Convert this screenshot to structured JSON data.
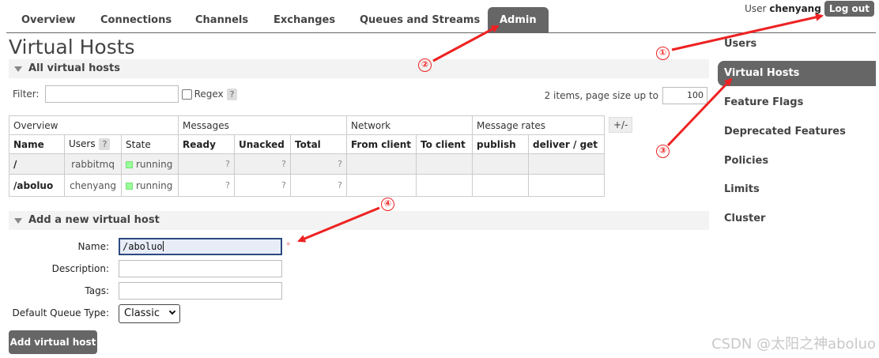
{
  "nav": {
    "tabs": [
      {
        "label": "Overview"
      },
      {
        "label": "Connections"
      },
      {
        "label": "Channels"
      },
      {
        "label": "Exchanges"
      },
      {
        "label": "Queues and Streams"
      },
      {
        "label": "Admin",
        "active": true
      }
    ]
  },
  "user": {
    "prefix": "User",
    "name": "chenyang",
    "logout": "Log out"
  },
  "page_title": "Virtual Hosts",
  "all_vhosts": {
    "header": "All virtual hosts",
    "filter_label": "Filter:",
    "filter_value": "",
    "regex_label": "Regex",
    "help": "?",
    "items_text": "2 items, page size up to",
    "page_size": "100",
    "toggle": "+/-"
  },
  "table": {
    "groups": [
      "Overview",
      "Messages",
      "Network",
      "Message rates"
    ],
    "columns": [
      "Name",
      "Users",
      "State",
      "Ready",
      "Unacked",
      "Total",
      "From client",
      "To client",
      "publish",
      "deliver / get"
    ],
    "users_help": "?",
    "rows": [
      {
        "name": "/",
        "users": "rabbitmq",
        "state": "running",
        "ready": "?",
        "unacked": "?",
        "total": "?"
      },
      {
        "name": "/aboluo",
        "users": "chenyang",
        "state": "running",
        "ready": "?",
        "unacked": "?",
        "total": "?"
      }
    ]
  },
  "add_vhost": {
    "header": "Add a new virtual host",
    "name_label": "Name:",
    "name_value": "/aboluo",
    "required_mark": "*",
    "description_label": "Description:",
    "tags_label": "Tags:",
    "queue_type_label": "Default Queue Type:",
    "queue_type_value": "Classic",
    "submit": "Add virtual host"
  },
  "sidebar": {
    "items": [
      {
        "label": "Users"
      },
      {
        "label": "Virtual Hosts",
        "active": true
      },
      {
        "label": "Feature Flags"
      },
      {
        "label": "Deprecated Features"
      },
      {
        "label": "Policies"
      },
      {
        "label": "Limits"
      },
      {
        "label": "Cluster"
      }
    ]
  },
  "annotations": [
    "①",
    "②",
    "③",
    "④"
  ],
  "watermark": "CSDN @太阳之神aboluo",
  "colors": {
    "accent": "#666666",
    "arrow": "#e22222",
    "running": "#99ff99"
  }
}
